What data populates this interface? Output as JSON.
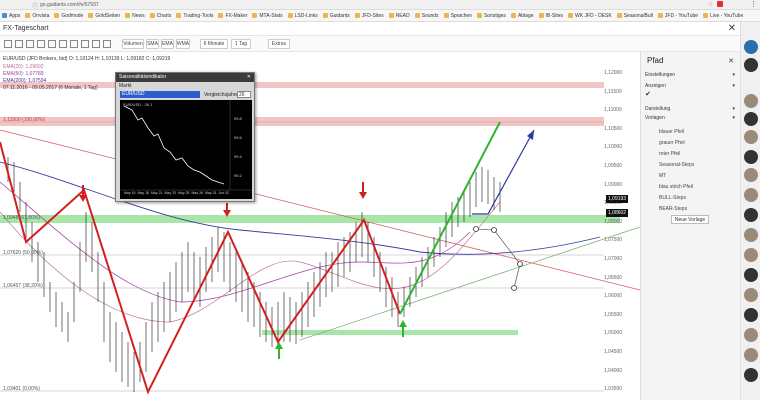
{
  "browser": {
    "url": "go.guidants.com/#v/57937",
    "minimize": "–",
    "close": "✕"
  },
  "bookmarks": [
    "Apps",
    "Onvista",
    "Godmode",
    "GoldSeiten",
    "News",
    "Charts",
    "Trading-Tools",
    "FX-Maker",
    "MTA-Stats",
    "LSD-Links",
    "Guidants",
    "JFD-Sites",
    "READ",
    "Sounds",
    "Sprachen",
    "Sonstiges",
    "Ablage",
    "IB-Sites",
    "WK JFD - DESK",
    "SeasonalBull",
    "JFD - YouTube",
    "Live - YouTube"
  ],
  "app": {
    "title": "FX-Tageschart",
    "close": "✕"
  },
  "toolbar": {
    "buttons": [
      "Volumen",
      "SMA",
      "EMA",
      "WMA",
      "6 Monate",
      "1 Tag",
      "Extras"
    ]
  },
  "chart": {
    "instrument_line": "EUR/USD (JFD Brokers, bid) O: 1,10124 H: 1,10139 L: 1,09182 C: 1,09219",
    "indicators": [
      "EMA(20): 1,09692",
      "EMA(50): 1,07789",
      "EMA(200): 1,07594",
      "07.11.2016 - 09.05.2017 (6 Monate, 1 Tag)"
    ],
    "fib_labels": [
      "1,11500 (100,00%)",
      "1,0948 (61,80%)",
      "1,07620 (50,00%)",
      "1,06457 (38,20%)",
      "1,03401 (0,00%)"
    ],
    "price_axis": [
      "1,12000",
      "1,11500",
      "1,11000",
      "1,10500",
      "1,10000",
      "1,09500",
      "1,09000",
      "1,08500",
      "1,08000",
      "1,07500",
      "1,07000",
      "1,06500",
      "1,06000",
      "1,05500",
      "1,05000",
      "1,04500",
      "1,04000",
      "1,03500"
    ],
    "price_tag_current": "1,09193",
    "price_tag_second": "1,08602"
  },
  "popup": {
    "title": "Saisonalitätsindikator",
    "menu": "Markt",
    "selected": "EUR/USD",
    "label": "Vergleichsjahre",
    "value": "26",
    "inner_label": "EUR/USD - 26.1",
    "axis_values": [
      "99.8",
      "99.6",
      "99.4",
      "99.2"
    ],
    "dates": [
      "May 16",
      "May 18",
      "May 21",
      "May 23",
      "May 25",
      "May 26",
      "May 31",
      "Jun 02"
    ]
  },
  "sidebar": {
    "title": "Pfad",
    "sections": [
      "Einstellungen",
      "Anzeigen",
      "Darstellung",
      "Vorlagen"
    ],
    "items": [
      "blauer Pfeil",
      "grauer Pfeil",
      "roter Pfeil",
      "Seasonal-Steps",
      "MT",
      "blau strich Pfeil",
      "BULL-Steps",
      "BEAR-Steps"
    ],
    "button": "Neue Vorlage"
  },
  "colors": {
    "bull": "#2db52d",
    "bear": "#d22020",
    "arrow_blue": "#2a3aa0",
    "fib_band": "#a8e6a8",
    "resistance": "#f0b8b8"
  }
}
